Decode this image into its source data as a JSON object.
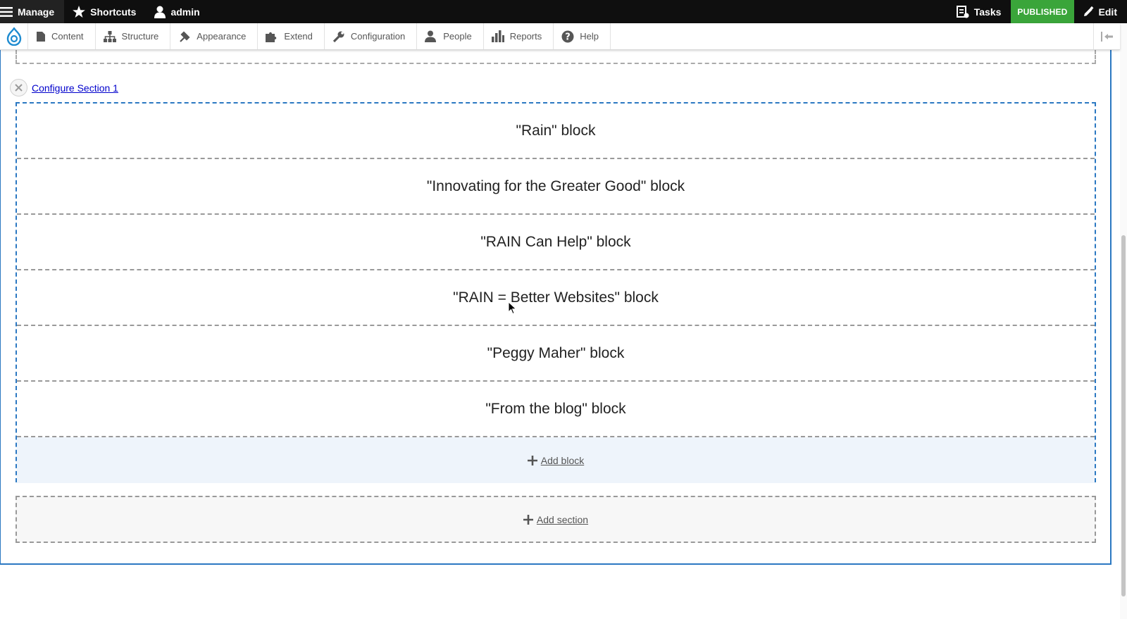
{
  "toolbar": {
    "manage_label": "Manage",
    "shortcuts_label": "Shortcuts",
    "user_label": "admin",
    "tasks_label": "Tasks",
    "status_badge": "PUBLISHED",
    "edit_label": "Edit"
  },
  "tray": {
    "items": [
      {
        "label": "Content",
        "icon": "content-icon"
      },
      {
        "label": "Structure",
        "icon": "structure-icon"
      },
      {
        "label": "Appearance",
        "icon": "appearance-icon"
      },
      {
        "label": "Extend",
        "icon": "extend-icon"
      },
      {
        "label": "Configuration",
        "icon": "configuration-icon"
      },
      {
        "label": "People",
        "icon": "people-icon"
      },
      {
        "label": "Reports",
        "icon": "reports-icon"
      },
      {
        "label": "Help",
        "icon": "help-icon"
      }
    ]
  },
  "layout_builder": {
    "configure_section_link": "Configure Section 1",
    "blocks": [
      "\"Rain\" block",
      "\"Innovating for the Greater Good\" block",
      "\"RAIN Can Help\" block",
      "\"RAIN = Better Websites\" block",
      "\"Peggy Maher\" block",
      "\"From the blog\" block"
    ],
    "add_block_label": "Add block",
    "add_section_label": "Add section"
  },
  "colors": {
    "accent_blue": "#2b78c2",
    "published_green": "#3aa53a",
    "toolbar_black": "#0f0f0f"
  }
}
